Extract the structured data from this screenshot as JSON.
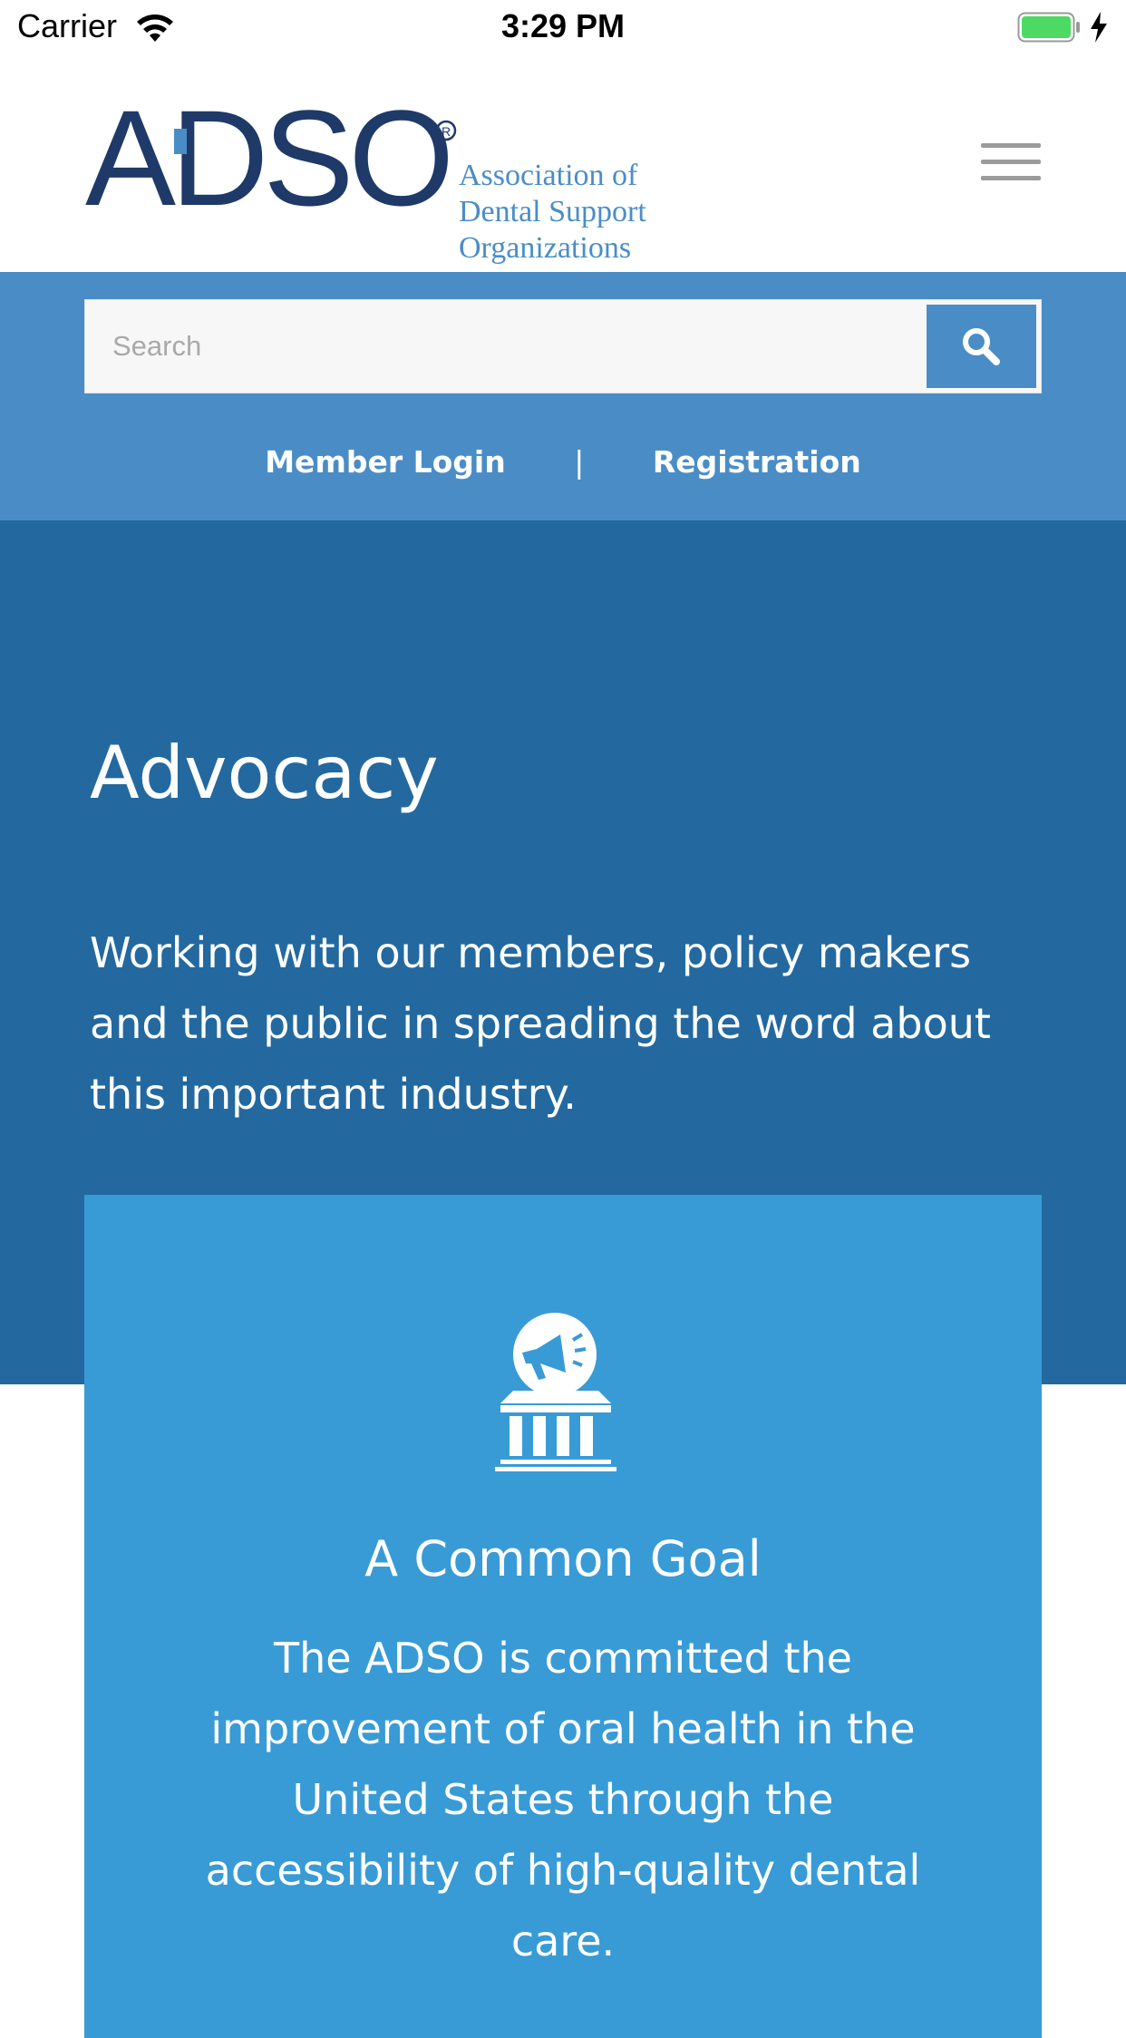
{
  "status_bar": {
    "carrier": "Carrier",
    "time": "3:29 PM"
  },
  "header": {
    "logo_text": "ADSO",
    "logo_tagline": [
      "Association of",
      "Dental Support",
      "Organizations"
    ],
    "menu_icon": "hamburger-icon"
  },
  "search": {
    "placeholder": "Search",
    "button_icon": "search-icon"
  },
  "top_links": {
    "login": "Member Login",
    "separator": "|",
    "registration": "Registration"
  },
  "hero": {
    "title": "Advocacy",
    "text": "Working with our members, policy makers and the public in spreading the word about this important industry."
  },
  "card": {
    "icon": "megaphone-government-building-icon",
    "title": "A Common Goal",
    "text": "The ADSO is committed the improvement of oral health in the United States through the accessibility of high-quality dental care."
  },
  "colors": {
    "search_band": "#4a8dc6",
    "hero_bg": "#2369a0",
    "card_bg": "#389bd6",
    "logo_navy": "#1f3a68",
    "logo_accent": "#4a8dc6"
  }
}
